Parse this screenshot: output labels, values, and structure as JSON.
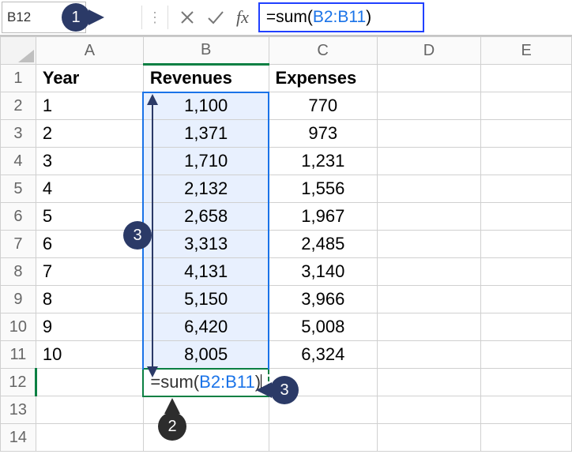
{
  "formula_bar": {
    "name_box": "B12",
    "fx_label": "fx",
    "formula_prefix": "=sum(",
    "formula_ref": "B2:B11",
    "formula_suffix": ")"
  },
  "columns": [
    "A",
    "B",
    "C",
    "D",
    "E"
  ],
  "row_numbers": [
    "1",
    "2",
    "3",
    "4",
    "5",
    "6",
    "7",
    "8",
    "9",
    "10",
    "11",
    "12",
    "13",
    "14"
  ],
  "headers": {
    "A": "Year",
    "B": "Revenues",
    "C": "Expenses"
  },
  "rows": [
    {
      "year": "1",
      "rev": "1,100",
      "exp": "770"
    },
    {
      "year": "2",
      "rev": "1,371",
      "exp": "973"
    },
    {
      "year": "3",
      "rev": "1,710",
      "exp": "1,231"
    },
    {
      "year": "4",
      "rev": "2,132",
      "exp": "1,556"
    },
    {
      "year": "5",
      "rev": "2,658",
      "exp": "1,967"
    },
    {
      "year": "6",
      "rev": "3,313",
      "exp": "2,485"
    },
    {
      "year": "7",
      "rev": "4,131",
      "exp": "3,140"
    },
    {
      "year": "8",
      "rev": "5,150",
      "exp": "3,966"
    },
    {
      "year": "9",
      "rev": "6,420",
      "exp": "5,008"
    },
    {
      "year": "10",
      "rev": "8,005",
      "exp": "6,324"
    }
  ],
  "active_cell": {
    "prefix": "=sum(",
    "ref": "B2:B11",
    "suffix": ")"
  },
  "callouts": {
    "c1": "1",
    "c2": "2",
    "c3": "3",
    "c3b": "3"
  },
  "chart_data": {
    "type": "table",
    "title": "",
    "columns": [
      "Year",
      "Revenues",
      "Expenses"
    ],
    "data": [
      [
        1,
        1100,
        770
      ],
      [
        2,
        1371,
        973
      ],
      [
        3,
        1710,
        1231
      ],
      [
        4,
        2132,
        1556
      ],
      [
        5,
        2658,
        1967
      ],
      [
        6,
        3313,
        2485
      ],
      [
        7,
        4131,
        3140
      ],
      [
        8,
        5150,
        3966
      ],
      [
        9,
        6420,
        5008
      ],
      [
        10,
        8005,
        6324
      ]
    ],
    "formula": "=sum(B2:B11)",
    "active_cell": "B12"
  }
}
